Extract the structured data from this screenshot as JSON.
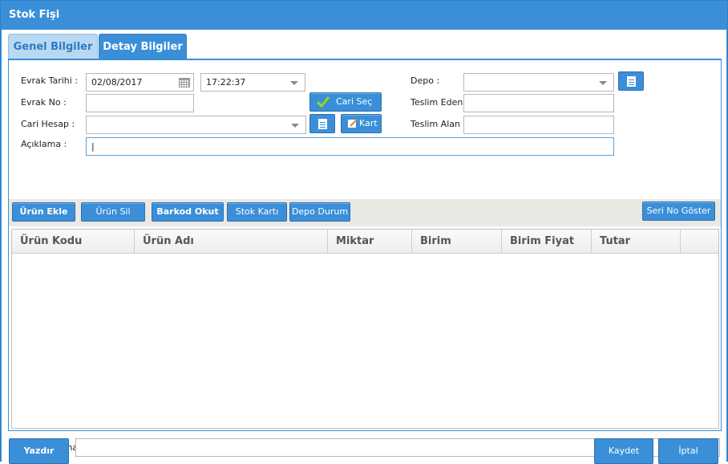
{
  "window": {
    "title": "Stok Fişi"
  },
  "tabs": [
    {
      "label": "Genel Bilgiler"
    },
    {
      "label": "Detay Bilgiler"
    }
  ],
  "form": {
    "evrak_tarihi_label": "Evrak Tarihi :",
    "evrak_tarihi_value": "02/08/2017",
    "evrak_saat_value": "17:22:37",
    "evrak_no_label": "Evrak No :",
    "evrak_no_value": "",
    "cari_hesap_label": "Cari Hesap :",
    "cari_hesap_value": "",
    "aciklama_label": "Açıklama :",
    "aciklama_value": "|",
    "depo_label": "Depo :",
    "depo_value": "",
    "teslim_eden_label": "Teslim Eden :",
    "teslim_eden_value": "",
    "teslim_alan_label": "Teslim Alan :",
    "teslim_alan_value": "",
    "cari_sec_label": "Cari Seç",
    "kart_label": "Kart"
  },
  "toolbar": {
    "urun_ekle": "Ürün Ekle",
    "urun_sil": "Ürün Sil",
    "barkod_okut": "Barkod Okut",
    "stok_karti": "Stok Kartı",
    "depo_durum": "Depo Durum",
    "seri_no_goster": "Seri No Göster"
  },
  "grid": {
    "columns": [
      "Ürün Kodu",
      "Ürün Adı",
      "Miktar",
      "Birim",
      "Birim Fiyat",
      "Tutar"
    ],
    "rows": []
  },
  "satir_aciklama": {
    "label": "Satır Açıklama :",
    "value": ""
  },
  "footer": {
    "yazdir": "Yazdır",
    "kaydet": "Kaydet",
    "iptal": "İptal"
  },
  "colors": {
    "accent": "#3a8fd8",
    "tab_active_bg": "#b9d9f2",
    "check": "#9bd61d"
  }
}
